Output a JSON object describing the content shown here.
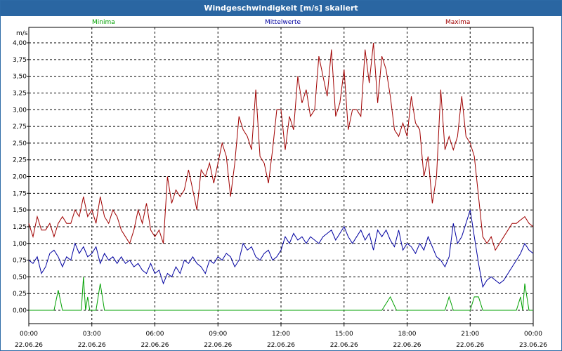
{
  "window": {
    "title": "Windgeschwindigkeit [m/s] skaliert"
  },
  "chart_data": {
    "type": "line",
    "title": "Windgeschwindigkeit [m/s] skaliert",
    "ylabel": "m/s",
    "ylim": [
      0,
      4
    ],
    "yticks": [
      "0,00",
      "0,25",
      "0,50",
      "0,75",
      "1,00",
      "1,25",
      "1,50",
      "1,75",
      "2,00",
      "2,25",
      "2,50",
      "2,75",
      "3,00",
      "3,25",
      "3,50",
      "3,75",
      "4,00"
    ],
    "xlim": [
      0,
      24
    ],
    "xticks": [
      {
        "time": "00:00",
        "date": "22.06.26"
      },
      {
        "time": "03:00",
        "date": "22.06.26"
      },
      {
        "time": "06:00",
        "date": "22.06.26"
      },
      {
        "time": "09:00",
        "date": "22.06.26"
      },
      {
        "time": "12:00",
        "date": "22.06.26"
      },
      {
        "time": "15:00",
        "date": "22.06.26"
      },
      {
        "time": "18:00",
        "date": "22.06.26"
      },
      {
        "time": "21:00",
        "date": "22.06.26"
      },
      {
        "time": "00:00",
        "date": "23.06.26"
      }
    ],
    "grid": true,
    "legend_position": "top",
    "series": [
      {
        "name": "Minima",
        "color": "#00a000",
        "x": [
          0,
          0.5,
          1,
          1.2,
          1.4,
          1.6,
          1.8,
          2.0,
          2.2,
          2.3,
          2.4,
          2.5,
          2.6,
          2.7,
          2.8,
          2.9,
          3.0,
          3.2,
          3.4,
          3.6,
          4,
          8,
          12,
          15,
          16,
          16.5,
          16.8,
          17.2,
          17.5,
          19,
          19.8,
          20.0,
          20.2,
          20.4,
          21.0,
          21.2,
          21.4,
          21.6,
          22,
          23,
          23.2,
          23.4,
          23.5,
          23.6,
          23.8,
          24
        ],
        "y": [
          0,
          0,
          0,
          0,
          0.3,
          0,
          0,
          0,
          0,
          0,
          0,
          0,
          0.5,
          0,
          0.2,
          0,
          0,
          0,
          0.4,
          0,
          0,
          0,
          0,
          0,
          0,
          0,
          0,
          0.2,
          0,
          0,
          0,
          0.2,
          0,
          0,
          0,
          0.2,
          0.2,
          0,
          0,
          0,
          0,
          0.2,
          0,
          0.4,
          0,
          0
        ]
      },
      {
        "name": "Mittelwerte",
        "color": "#0000a0",
        "x": [
          0,
          0.2,
          0.4,
          0.6,
          0.8,
          1,
          1.2,
          1.4,
          1.6,
          1.8,
          2,
          2.2,
          2.4,
          2.6,
          2.8,
          3,
          3.2,
          3.4,
          3.6,
          3.8,
          4,
          4.2,
          4.4,
          4.6,
          4.8,
          5,
          5.2,
          5.4,
          5.6,
          5.8,
          6,
          6.2,
          6.4,
          6.6,
          6.8,
          7,
          7.2,
          7.4,
          7.6,
          7.8,
          8,
          8.2,
          8.4,
          8.6,
          8.8,
          9,
          9.2,
          9.4,
          9.6,
          9.8,
          10,
          10.2,
          10.4,
          10.6,
          10.8,
          11,
          11.2,
          11.4,
          11.6,
          11.8,
          12,
          12.2,
          12.4,
          12.6,
          12.8,
          13,
          13.2,
          13.4,
          13.6,
          13.8,
          14,
          14.2,
          14.4,
          14.6,
          14.8,
          15,
          15.2,
          15.4,
          15.6,
          15.8,
          16,
          16.2,
          16.4,
          16.6,
          16.8,
          17,
          17.2,
          17.4,
          17.6,
          17.8,
          18,
          18.2,
          18.4,
          18.6,
          18.8,
          19,
          19.2,
          19.4,
          19.6,
          19.8,
          20,
          20.2,
          20.4,
          20.6,
          20.8,
          21,
          21.2,
          21.4,
          21.6,
          21.8,
          22,
          22.2,
          22.4,
          22.6,
          22.8,
          23,
          23.2,
          23.4,
          23.6,
          23.8,
          24
        ],
        "y": [
          0.75,
          0.7,
          0.8,
          0.55,
          0.65,
          0.85,
          0.9,
          0.8,
          0.65,
          0.8,
          0.75,
          1.0,
          0.85,
          0.95,
          0.8,
          0.85,
          0.95,
          0.7,
          0.85,
          0.75,
          0.8,
          0.7,
          0.8,
          0.7,
          0.75,
          0.65,
          0.7,
          0.6,
          0.55,
          0.7,
          0.55,
          0.6,
          0.4,
          0.55,
          0.5,
          0.65,
          0.55,
          0.75,
          0.7,
          0.8,
          0.7,
          0.65,
          0.55,
          0.75,
          0.7,
          0.8,
          0.75,
          0.85,
          0.8,
          0.65,
          0.75,
          1.0,
          0.9,
          0.95,
          0.8,
          0.75,
          0.85,
          0.9,
          0.75,
          0.8,
          0.9,
          1.1,
          1.0,
          1.15,
          1.05,
          1.1,
          1.0,
          1.1,
          1.05,
          1.0,
          1.1,
          1.15,
          1.2,
          1.05,
          1.15,
          1.25,
          1.1,
          1.0,
          1.1,
          1.2,
          1.05,
          1.15,
          0.9,
          1.2,
          1.1,
          1.2,
          1.05,
          0.95,
          1.2,
          0.9,
          1.0,
          0.95,
          0.85,
          1.0,
          0.9,
          1.1,
          0.95,
          0.8,
          0.75,
          0.65,
          0.8,
          1.3,
          1.0,
          1.1,
          1.3,
          1.5,
          1.1,
          0.7,
          0.35,
          0.45,
          0.5,
          0.45,
          0.4,
          0.45,
          0.55,
          0.65,
          0.75,
          0.85,
          1.0,
          0.9,
          0.85
        ]
      },
      {
        "name": "Maxima",
        "color": "#a00000",
        "x": [
          0,
          0.2,
          0.4,
          0.6,
          0.8,
          1,
          1.2,
          1.4,
          1.6,
          1.8,
          2,
          2.2,
          2.4,
          2.6,
          2.8,
          3,
          3.2,
          3.4,
          3.6,
          3.8,
          4,
          4.2,
          4.4,
          4.6,
          4.8,
          5,
          5.2,
          5.4,
          5.6,
          5.8,
          6,
          6.2,
          6.4,
          6.6,
          6.8,
          7,
          7.2,
          7.4,
          7.6,
          7.8,
          8,
          8.2,
          8.4,
          8.6,
          8.8,
          9,
          9.2,
          9.4,
          9.6,
          9.8,
          10,
          10.2,
          10.4,
          10.6,
          10.8,
          11,
          11.2,
          11.4,
          11.6,
          11.8,
          12,
          12.2,
          12.4,
          12.6,
          12.8,
          13,
          13.2,
          13.4,
          13.6,
          13.8,
          14,
          14.2,
          14.4,
          14.6,
          14.8,
          15,
          15.2,
          15.4,
          15.6,
          15.8,
          16,
          16.2,
          16.4,
          16.6,
          16.8,
          17,
          17.2,
          17.4,
          17.6,
          17.8,
          18,
          18.2,
          18.4,
          18.6,
          18.8,
          19,
          19.2,
          19.4,
          19.6,
          19.8,
          20,
          20.2,
          20.4,
          20.6,
          20.8,
          21,
          21.2,
          21.4,
          21.6,
          21.8,
          22,
          22.2,
          22.4,
          22.6,
          22.8,
          23,
          23.2,
          23.4,
          23.6,
          23.8,
          24
        ],
        "y": [
          1.3,
          1.1,
          1.4,
          1.2,
          1.2,
          1.3,
          1.1,
          1.3,
          1.4,
          1.3,
          1.3,
          1.5,
          1.4,
          1.7,
          1.4,
          1.5,
          1.3,
          1.7,
          1.4,
          1.3,
          1.5,
          1.4,
          1.2,
          1.1,
          1.0,
          1.2,
          1.5,
          1.3,
          1.6,
          1.2,
          1.1,
          1.2,
          1.0,
          2.0,
          1.6,
          1.8,
          1.7,
          1.8,
          2.1,
          1.8,
          1.5,
          2.1,
          2.0,
          2.2,
          1.9,
          2.2,
          2.5,
          2.3,
          1.7,
          2.2,
          2.9,
          2.7,
          2.6,
          2.4,
          3.3,
          2.3,
          2.2,
          1.9,
          2.4,
          3.0,
          3.0,
          2.4,
          2.9,
          2.7,
          3.5,
          3.1,
          3.3,
          2.9,
          3.0,
          3.8,
          3.5,
          3.2,
          3.9,
          2.9,
          3.1,
          3.6,
          2.7,
          3.0,
          3.0,
          2.9,
          3.9,
          3.4,
          4.0,
          3.1,
          3.8,
          3.6,
          3.2,
          2.7,
          2.6,
          2.8,
          2.6,
          3.2,
          2.8,
          2.7,
          2.0,
          2.3,
          1.6,
          2.0,
          3.3,
          2.4,
          2.6,
          2.4,
          2.6,
          3.2,
          2.6,
          2.5,
          2.3,
          1.7,
          1.1,
          1.0,
          1.1,
          0.9,
          1.0,
          1.1,
          1.2,
          1.3,
          1.3,
          1.35,
          1.4,
          1.3,
          1.25
        ]
      }
    ]
  }
}
